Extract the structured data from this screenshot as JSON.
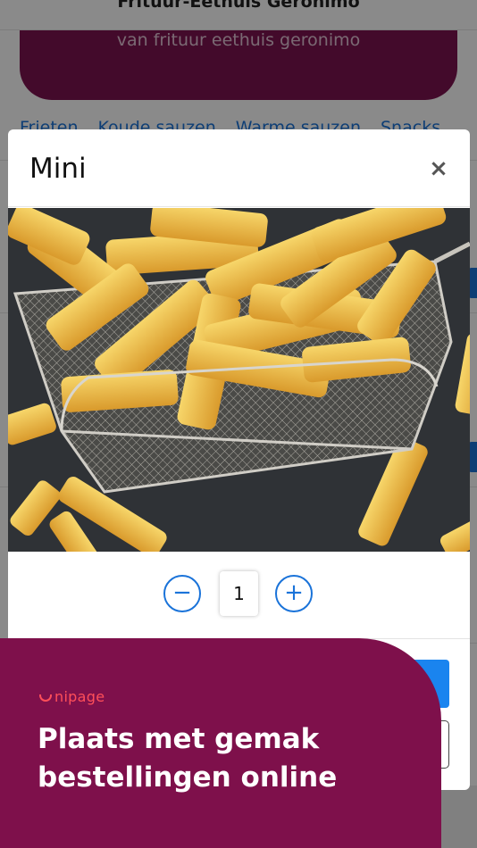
{
  "header": {
    "title": "Frituur-Eethuis Geronimo"
  },
  "hero": {
    "subtitle": "van frituur eethuis geronimo"
  },
  "categories": [
    "Frieten",
    "Koude sauzen",
    "Warme sauzen",
    "Snacks"
  ],
  "modal": {
    "title": "Mini",
    "close_symbol": "×",
    "image_alt": "fries-in-basket",
    "quantity": {
      "minus_symbol": "−",
      "value": "1",
      "plus_symbol": "+"
    }
  },
  "promo": {
    "brand": "nipage",
    "headline_line1": "Plaats met gemak",
    "headline_line2": "bestellingen online"
  },
  "colors": {
    "brand_purple": "#7e104b",
    "accent_blue": "#1a73d9",
    "primary_button": "#1a84ef",
    "brand_red": "#ff4f59"
  }
}
